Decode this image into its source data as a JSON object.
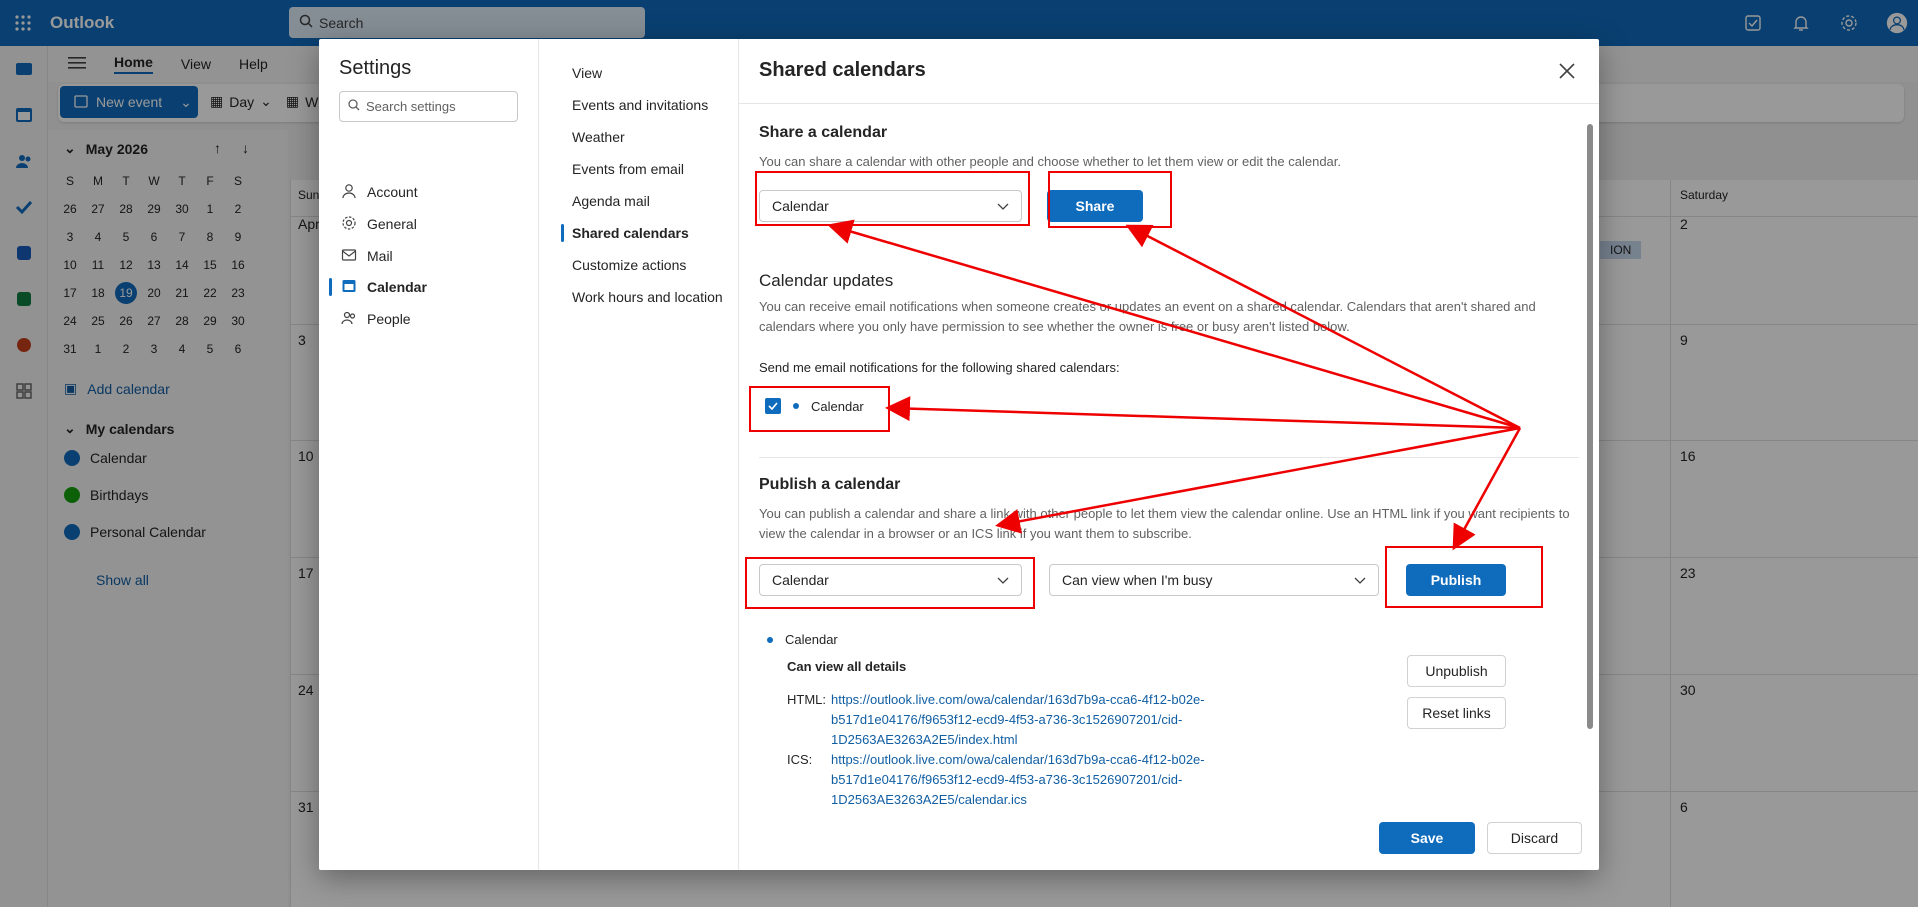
{
  "app": {
    "name": "Outlook",
    "search_placeholder": "Search"
  },
  "ribbon": {
    "tabs": [
      "Home",
      "View",
      "Help"
    ],
    "new_event": "New event",
    "day": "Day",
    "week_partial": "W"
  },
  "mini_calendar": {
    "title": "May 2026",
    "weekdays": [
      "S",
      "M",
      "T",
      "W",
      "T",
      "F",
      "S"
    ],
    "days": [
      "26",
      "27",
      "28",
      "29",
      "30",
      "1",
      "2",
      "3",
      "4",
      "5",
      "6",
      "7",
      "8",
      "9",
      "10",
      "11",
      "12",
      "13",
      "14",
      "15",
      "16",
      "17",
      "18",
      "19",
      "20",
      "21",
      "22",
      "23",
      "24",
      "25",
      "26",
      "27",
      "28",
      "29",
      "30",
      "31",
      "1",
      "2",
      "3",
      "4",
      "5",
      "6"
    ],
    "today": "19"
  },
  "left_pane": {
    "add_calendar": "Add calendar",
    "my_calendars": "My calendars",
    "calendars": [
      "Calendar",
      "Birthdays",
      "Personal Calendar"
    ],
    "show_all": "Show all"
  },
  "calendar_view": {
    "col_first": "Sun",
    "col_last": "Saturday",
    "first_label": "Apr",
    "event_partial": "ION",
    "left_numbers": [
      "3",
      "10",
      "17",
      "24",
      "31"
    ],
    "right_numbers": [
      "2",
      "9",
      "16",
      "23",
      "30",
      "6"
    ]
  },
  "settings": {
    "title": "Settings",
    "search_placeholder": "Search settings",
    "nav": [
      {
        "label": "Account",
        "icon": "person-icon"
      },
      {
        "label": "General",
        "icon": "gear-icon"
      },
      {
        "label": "Mail",
        "icon": "mail-icon"
      },
      {
        "label": "Calendar",
        "icon": "calendar-icon"
      },
      {
        "label": "People",
        "icon": "people-icon"
      }
    ],
    "subnav": [
      "View",
      "Events and invitations",
      "Weather",
      "Events from email",
      "Agenda mail",
      "Shared calendars",
      "Customize actions",
      "Work hours and location"
    ]
  },
  "shared": {
    "title": "Shared calendars",
    "share_heading": "Share a calendar",
    "share_desc": "You can share a calendar with other people and choose whether to let them view or edit the calendar.",
    "share_dropdown": "Calendar",
    "share_button": "Share",
    "updates_heading": "Calendar updates",
    "updates_desc": "You can receive email notifications when someone creates or updates an event on a shared calendar. Calendars that aren't shared and calendars where you only have permission to see whether the owner is free or busy aren't listed below.",
    "notif_label": "Send me email notifications for the following shared calendars:",
    "notif_calendar": "Calendar",
    "publish_heading": "Publish a calendar",
    "publish_desc": "You can publish a calendar and share a link with other people to let them view the calendar online. Use an HTML link if you want recipients to view the calendar in a browser or an ICS link if you want them to subscribe.",
    "publish_dropdown": "Calendar",
    "permission_dropdown": "Can view when I'm busy",
    "publish_button": "Publish",
    "published_name": "Calendar",
    "published_perm": "Can view all details",
    "html_label": "HTML:",
    "html_link_1": "https://outlook.live.com/owa/calendar/163d7b9a-cca6-4f12-b02e-",
    "html_link_2": "b517d1e04176/f9653f12-ecd9-4f53-a736-3c1526907201/cid-",
    "html_link_3": "1D2563AE3263A2E5/index.html",
    "ics_label": "ICS:",
    "ics_link_1": "https://outlook.live.com/owa/calendar/163d7b9a-cca6-4f12-b02e-",
    "ics_link_2": "b517d1e04176/f9653f12-ecd9-4f53-a736-3c1526907201/cid-",
    "ics_link_3": "1D2563AE3263A2E5/calendar.ics",
    "unpublish": "Unpublish",
    "reset_links": "Reset links",
    "save": "Save",
    "discard": "Discard"
  },
  "colors": {
    "brand": "#0f6cbd",
    "annotation": "#e00000",
    "birthdays": "#13a10e"
  }
}
